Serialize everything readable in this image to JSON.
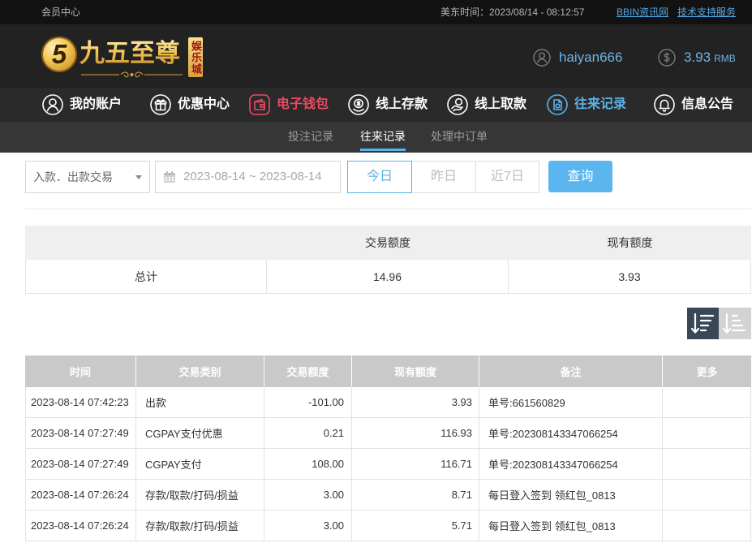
{
  "topbar": {
    "member_center": "会员中心",
    "time": "美东时间：2023/08/14 - 08:12:57",
    "links": [
      "BBIN资讯网",
      "技术支持服务"
    ]
  },
  "logo": {
    "mark": "5",
    "name": "九五至尊",
    "tag": "娱乐城"
  },
  "user": {
    "username": "haiyan666",
    "balance": "3.93",
    "currency": "RMB",
    "icons": [
      "user-circle-icon",
      "dollar-circle-icon"
    ]
  },
  "nav": [
    {
      "label": "我的账户",
      "icon": "user-icon"
    },
    {
      "label": "优惠中心",
      "icon": "gift-icon"
    },
    {
      "label": "电子钱包",
      "icon": "wallet-icon",
      "color": "#ea4a60"
    },
    {
      "label": "线上存款",
      "icon": "deposit-icon"
    },
    {
      "label": "线上取款",
      "icon": "withdraw-icon"
    },
    {
      "label": "往来记录",
      "icon": "records-icon",
      "active": true,
      "color": "#5bb3ea"
    },
    {
      "label": "信息公告",
      "icon": "bell-icon"
    }
  ],
  "subnav": {
    "items": [
      "投注记录",
      "往来记录",
      "处理中订单"
    ],
    "active": "往来记录"
  },
  "filters": {
    "type_select": "入款．出款交易",
    "date_icon": "calendar-icon",
    "date_range": "2023-08-14 ~ 2023-08-14",
    "periods": [
      "今日",
      "昨日",
      "近7日"
    ],
    "active_period": "今日",
    "query_label": "查询"
  },
  "summary": {
    "headers": [
      "交易额度",
      "现有额度"
    ],
    "row": {
      "label": "总计",
      "amount": "14.96",
      "balance": "3.93"
    }
  },
  "sort": {
    "buttons": [
      "sort-desc-icon",
      "sort-asc-icon"
    ],
    "active": "sort-desc-icon"
  },
  "transactions": {
    "headers": [
      "时间",
      "交易类别",
      "交易额度",
      "现有额度",
      "备注",
      "更多"
    ],
    "rows": [
      [
        "2023-08-14 07:42:23",
        "出款",
        "-101.00",
        "3.93",
        "单号:661560829"
      ],
      [
        "2023-08-14 07:27:49",
        "CGPAY支付优惠",
        "0.21",
        "116.93",
        "单号:202308143347066254"
      ],
      [
        "2023-08-14 07:27:49",
        "CGPAY支付",
        "108.00",
        "116.71",
        "单号:202308143347066254"
      ],
      [
        "2023-08-14 07:26:24",
        "存款/取款/打码/损益",
        "3.00",
        "8.71",
        "每日登入签到 领红包_0813"
      ],
      [
        "2023-08-14 07:26:24",
        "存款/取款/打码/损益",
        "3.00",
        "5.71",
        "每日登入签到 领红包_0813"
      ]
    ]
  },
  "colors": {
    "accent": "#5bb3ea",
    "wallet_red": "#ea4a60",
    "gold": "#f1c04e",
    "link": "#4fa8e8",
    "query_button": "#5bb6f0",
    "table_header": "#c9c9c9"
  }
}
